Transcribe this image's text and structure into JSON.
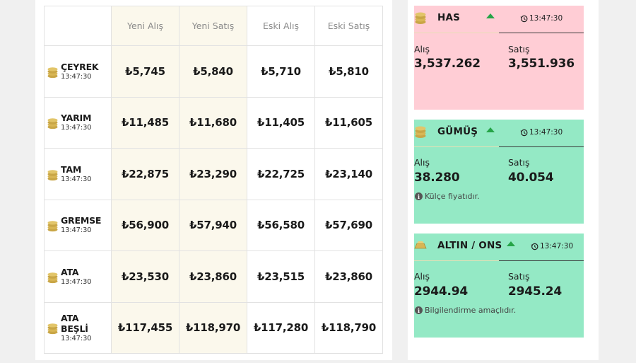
{
  "table": {
    "headers": [
      "",
      "Yeni Alış",
      "Yeni Satış",
      "Eski Alış",
      "Eski Satış"
    ],
    "rows": [
      {
        "name": "ÇEYREK",
        "time": "13:47:30",
        "values": [
          "₺5,745",
          "₺5,840",
          "₺5,710",
          "₺5,810"
        ]
      },
      {
        "name": "YARIM",
        "time": "13:47:30",
        "values": [
          "₺11,485",
          "₺11,680",
          "₺11,405",
          "₺11,605"
        ]
      },
      {
        "name": "TAM",
        "time": "13:47:30",
        "values": [
          "₺22,875",
          "₺23,290",
          "₺22,725",
          "₺23,140"
        ]
      },
      {
        "name": "GREMSE",
        "time": "13:47:30",
        "values": [
          "₺56,900",
          "₺57,940",
          "₺56,580",
          "₺57,690"
        ]
      },
      {
        "name": "ATA",
        "time": "13:47:30",
        "values": [
          "₺23,530",
          "₺23,860",
          "₺23,515",
          "₺23,860"
        ]
      },
      {
        "name": "ATA BEŞLİ",
        "name_line1": "ATA",
        "name_line2": "BEŞLİ",
        "time": "13:47:30",
        "values": [
          "₺117,455",
          "₺118,970",
          "₺117,280",
          "₺118,790"
        ]
      }
    ]
  },
  "cards": {
    "has": {
      "title": "HAS",
      "time": "13:47:30",
      "buy_label": "Alış",
      "buy": "3,537.262",
      "sell_label": "Satış",
      "sell": "3,551.936",
      "trend": "up"
    },
    "gumus": {
      "title": "GÜMÜŞ",
      "time": "13:47:30",
      "buy_label": "Alış",
      "buy": "38.280",
      "sell_label": "Satış",
      "sell": "40.054",
      "note": "Külçe fiyatıdır.",
      "trend": "up"
    },
    "altin_ons": {
      "title": "ALTIN / ONS",
      "time": "13:47:30",
      "buy_label": "Alış",
      "buy": "2944.94",
      "sell_label": "Satış",
      "sell": "2945.24",
      "note": "Bilgilendirme amaçlıdır.",
      "trend": "up"
    }
  },
  "colors": {
    "pink_card": "#ffcdd5",
    "green_card": "#94e9c5",
    "trend_up": "#25a447",
    "highlight_column": "#fbf8ec"
  },
  "icons": [
    "coin-stack-icon",
    "arrow-up-icon",
    "history-clock-icon",
    "info-icon",
    "gold-bar-icon"
  ]
}
